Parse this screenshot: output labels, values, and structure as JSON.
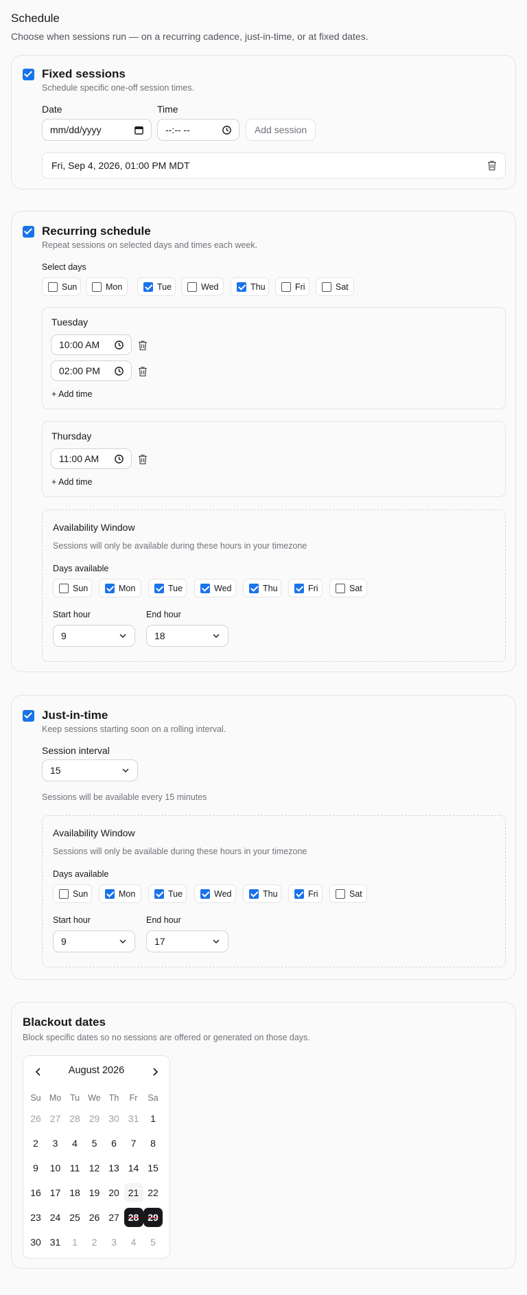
{
  "header": {
    "title": "Schedule",
    "subtitle": "Choose when sessions run — on a recurring cadence, just-in-time, or at fixed dates."
  },
  "fixed": {
    "enabled": true,
    "title": "Fixed sessions",
    "description": "Schedule specific one-off session times.",
    "date_label": "Date",
    "date_placeholder": "mm/dd/yyyy",
    "time_label": "Time",
    "time_placeholder": "--:-- --",
    "add_button": "Add session",
    "sessions": [
      "Fri, Sep 4, 2026, 01:00 PM MDT"
    ]
  },
  "recurring": {
    "enabled": true,
    "title": "Recurring schedule",
    "description": "Repeat sessions on selected days and times each week.",
    "select_days_label": "Select days",
    "days": [
      {
        "label": "Sun",
        "checked": false
      },
      {
        "label": "Mon",
        "checked": false
      },
      {
        "label": "Tue",
        "checked": true
      },
      {
        "label": "Wed",
        "checked": false
      },
      {
        "label": "Thu",
        "checked": true
      },
      {
        "label": "Fri",
        "checked": false
      },
      {
        "label": "Sat",
        "checked": false
      }
    ],
    "day_blocks": [
      {
        "name": "Tuesday",
        "times": [
          "10:00 AM",
          "02:00 PM"
        ],
        "add_time": "+ Add time"
      },
      {
        "name": "Thursday",
        "times": [
          "11:00 AM"
        ],
        "add_time": "+ Add time"
      }
    ],
    "availability": {
      "title": "Availability Window",
      "description": "Sessions will only be available during these hours in your timezone",
      "days_label": "Days available",
      "days": [
        {
          "label": "Sun",
          "checked": false
        },
        {
          "label": "Mon",
          "checked": true
        },
        {
          "label": "Tue",
          "checked": true
        },
        {
          "label": "Wed",
          "checked": true
        },
        {
          "label": "Thu",
          "checked": true
        },
        {
          "label": "Fri",
          "checked": true
        },
        {
          "label": "Sat",
          "checked": false
        }
      ],
      "start_label": "Start hour",
      "start_value": "9",
      "end_label": "End hour",
      "end_value": "18"
    }
  },
  "jit": {
    "enabled": true,
    "title": "Just-in-time",
    "description": "Keep sessions starting soon on a rolling interval.",
    "interval_label": "Session interval",
    "interval_value": "15",
    "interval_note": "Sessions will be available every 15 minutes",
    "availability": {
      "title": "Availability Window",
      "description": "Sessions will only be available during these hours in your timezone",
      "days_label": "Days available",
      "days": [
        {
          "label": "Sun",
          "checked": false
        },
        {
          "label": "Mon",
          "checked": true
        },
        {
          "label": "Tue",
          "checked": true
        },
        {
          "label": "Wed",
          "checked": true
        },
        {
          "label": "Thu",
          "checked": true
        },
        {
          "label": "Fri",
          "checked": true
        },
        {
          "label": "Sat",
          "checked": false
        }
      ],
      "start_label": "Start hour",
      "start_value": "9",
      "end_label": "End hour",
      "end_value": "17"
    }
  },
  "blackout": {
    "title": "Blackout dates",
    "description": "Block specific dates so no sessions are offered or generated on those days.",
    "calendar": {
      "month_label": "August 2026",
      "weekdays": [
        "Su",
        "Mo",
        "Tu",
        "We",
        "Th",
        "Fr",
        "Sa"
      ],
      "weeks": [
        [
          {
            "d": "26",
            "out": true
          },
          {
            "d": "27",
            "out": true
          },
          {
            "d": "28",
            "out": true
          },
          {
            "d": "29",
            "out": true
          },
          {
            "d": "30",
            "out": true
          },
          {
            "d": "31",
            "out": true
          },
          {
            "d": "1"
          }
        ],
        [
          {
            "d": "2"
          },
          {
            "d": "3"
          },
          {
            "d": "4"
          },
          {
            "d": "5"
          },
          {
            "d": "6"
          },
          {
            "d": "7"
          },
          {
            "d": "8"
          }
        ],
        [
          {
            "d": "9"
          },
          {
            "d": "10"
          },
          {
            "d": "11"
          },
          {
            "d": "12"
          },
          {
            "d": "13"
          },
          {
            "d": "14"
          },
          {
            "d": "15"
          }
        ],
        [
          {
            "d": "16"
          },
          {
            "d": "17"
          },
          {
            "d": "18"
          },
          {
            "d": "19"
          },
          {
            "d": "20"
          },
          {
            "d": "21",
            "today": true
          },
          {
            "d": "22"
          }
        ],
        [
          {
            "d": "23"
          },
          {
            "d": "24"
          },
          {
            "d": "25"
          },
          {
            "d": "26"
          },
          {
            "d": "27"
          },
          {
            "d": "28",
            "blocked": true
          },
          {
            "d": "29",
            "blocked": true
          }
        ],
        [
          {
            "d": "30"
          },
          {
            "d": "31"
          },
          {
            "d": "1",
            "out": true
          },
          {
            "d": "2",
            "out": true
          },
          {
            "d": "3",
            "out": true
          },
          {
            "d": "4",
            "out": true
          },
          {
            "d": "5",
            "out": true
          }
        ]
      ]
    }
  },
  "colors": {
    "accent": "#1a73e8",
    "blocked": "#18181b",
    "blocked_text": "#f43f5e"
  }
}
